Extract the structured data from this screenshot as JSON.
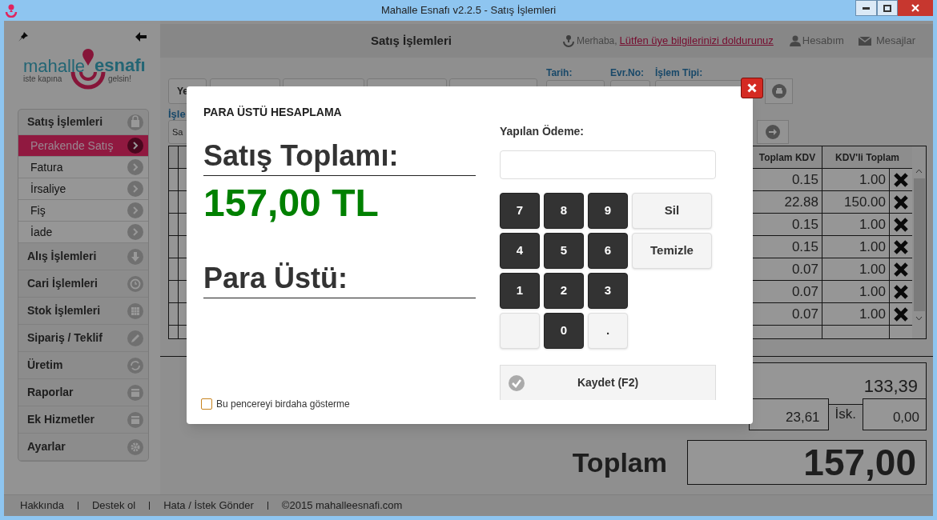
{
  "window": {
    "title": "Mahalle Esnafı v2.2.5 - Satış İşlemleri"
  },
  "logo": {
    "word_1": "mahalle",
    "word_2": "esnafı",
    "tagline_1": "iste kapına",
    "tagline_2": "gelsin!"
  },
  "sidebar": {
    "menu": [
      {
        "label": "Satış İşlemleri",
        "children": [
          {
            "label": "Perakende Satış",
            "selected": true
          },
          {
            "label": "Fatura",
            "selected": false
          },
          {
            "label": "İrsaliye",
            "selected": false
          },
          {
            "label": "Fiş",
            "selected": false
          },
          {
            "label": "İade",
            "selected": false
          }
        ]
      },
      {
        "label": "Alış İşlemleri"
      },
      {
        "label": "Cari İşlemleri"
      },
      {
        "label": "Stok İşlemleri"
      },
      {
        "label": "Sipariş / Teklif"
      },
      {
        "label": "Üretim"
      },
      {
        "label": "Raporlar"
      },
      {
        "label": "Ek Hizmetler"
      },
      {
        "label": "Ayarlar"
      }
    ]
  },
  "header": {
    "title": "Satış İşlemleri",
    "greeting": "Merhaba,",
    "profile_link": "Lütfen üye bilgilerinizi doldurunuz",
    "account": "Hesabım",
    "messages": "Mesajlar"
  },
  "toolbar": {
    "button_1": "Ye",
    "fields": [
      {
        "label": "Tarih:"
      },
      {
        "label": "Evr.No:"
      },
      {
        "label": "İşlem Tipi:"
      }
    ],
    "label_2": "İşle",
    "button_2": "Sa"
  },
  "table": {
    "columns": [
      "Toplam KDV",
      "KDV'li Toplam"
    ],
    "rows": [
      [
        "0.15",
        "1.00"
      ],
      [
        "22.88",
        "150.00"
      ],
      [
        "0.15",
        "1.00"
      ],
      [
        "0.15",
        "1.00"
      ],
      [
        "0.07",
        "1.00"
      ],
      [
        "0.07",
        "1.00"
      ],
      [
        "0.07",
        "1.00"
      ]
    ]
  },
  "totals": {
    "subtotal": "133,39",
    "kdv": "23,61",
    "discount_label": "İsk.",
    "discount": "0,00",
    "total_label": "Toplam",
    "total": "157,00"
  },
  "footer": {
    "links": [
      "Hakkında",
      "Destek ol",
      "Hata / İstek Gönder"
    ],
    "copyright": "©2015 mahalleesnafi.com"
  },
  "dialog": {
    "title": "PARA ÜSTÜ HESAPLAMA",
    "sale_total_label": "Satış Toplamı:",
    "sale_total": "157,00 TL",
    "change_label": "Para Üstü:",
    "payment_label": "Yapılan Ödeme:",
    "keys": [
      {
        "kind": "digit",
        "label": "7"
      },
      {
        "kind": "digit",
        "label": "8"
      },
      {
        "kind": "digit",
        "label": "9"
      },
      {
        "kind": "digit",
        "label": "4"
      },
      {
        "kind": "digit",
        "label": "5"
      },
      {
        "kind": "digit",
        "label": "6"
      },
      {
        "kind": "digit",
        "label": "1"
      },
      {
        "kind": "digit",
        "label": "2"
      },
      {
        "kind": "digit",
        "label": "3"
      },
      {
        "kind": "blank"
      },
      {
        "kind": "digit",
        "label": "0"
      },
      {
        "kind": "symbol",
        "label": "."
      }
    ],
    "actions": [
      "Sil",
      "Temizle"
    ],
    "save_button": "Kaydet (F2)",
    "dont_show": {
      "label": "Bu pencereyi birdaha gösterme",
      "checked": false
    }
  }
}
